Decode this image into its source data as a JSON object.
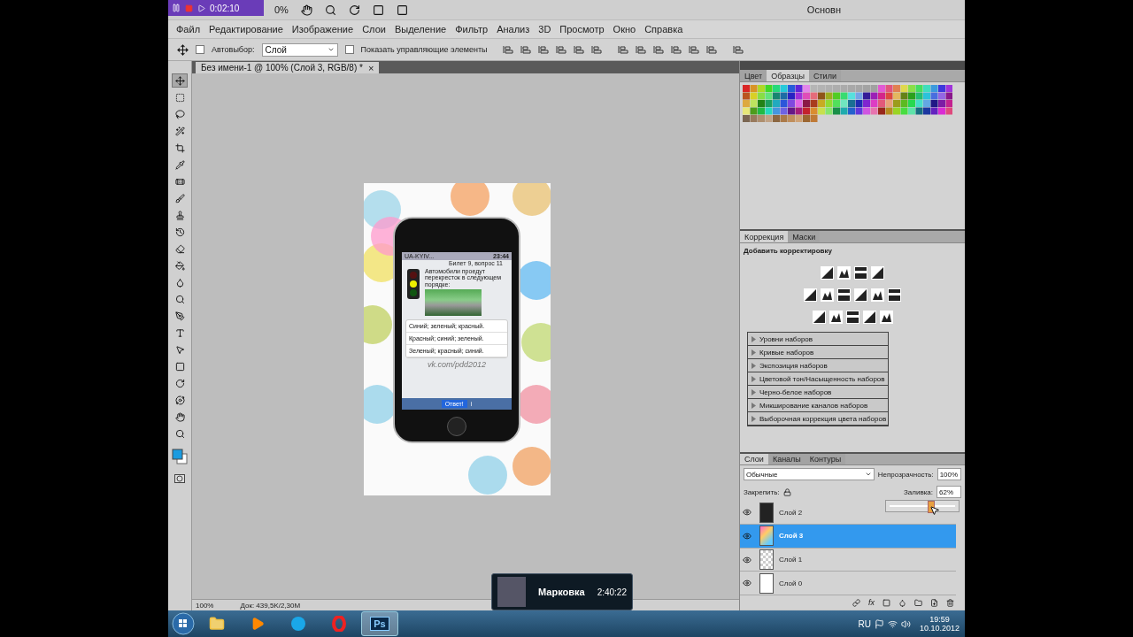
{
  "recorder": {
    "time": "0:02:10"
  },
  "app_bar": {
    "zoom": "0%",
    "workspace": "Основн"
  },
  "menu": [
    "Файл",
    "Редактирование",
    "Изображение",
    "Слои",
    "Выделение",
    "Фильтр",
    "Анализ",
    "3D",
    "Просмотр",
    "Окно",
    "Справка"
  ],
  "options": {
    "auto_select": {
      "label": "Автовыбор:",
      "checked": false
    },
    "auto_select_value": "Слой",
    "show_controls": {
      "label": "Показать управляющие элементы",
      "checked": false
    }
  },
  "document_tab": {
    "title": "Без имени-1 @ 100% (Слой 3, RGB/8) *",
    "close": "×"
  },
  "tools": [
    {
      "kind": "move",
      "selected": true
    },
    {
      "kind": "marquee",
      "selected": false
    },
    {
      "kind": "lasso",
      "selected": false
    },
    {
      "kind": "wand",
      "selected": false
    },
    {
      "kind": "crop",
      "selected": false
    },
    {
      "kind": "eyedropper",
      "selected": false
    },
    {
      "kind": "healing",
      "selected": false
    },
    {
      "kind": "brush",
      "selected": false
    },
    {
      "kind": "stamp",
      "selected": false
    },
    {
      "kind": "history",
      "selected": false
    },
    {
      "kind": "eraser",
      "selected": false
    },
    {
      "kind": "gradient",
      "selected": false
    },
    {
      "kind": "blur",
      "selected": false
    },
    {
      "kind": "dodge",
      "selected": false
    },
    {
      "kind": "pen",
      "selected": false
    },
    {
      "kind": "type",
      "selected": false
    },
    {
      "kind": "path",
      "selected": false
    },
    {
      "kind": "shape",
      "selected": false
    },
    {
      "kind": "rotate",
      "selected": false
    },
    {
      "kind": "orbit",
      "selected": false
    },
    {
      "kind": "hand",
      "selected": false
    },
    {
      "kind": "zoom",
      "selected": false
    }
  ],
  "phone": {
    "carrier": "UA-KYIV...",
    "time": "23:44",
    "title": "Билет 9, вопрос 11",
    "question": "Автомобили проедут перекресток в следующем порядке:",
    "answers": [
      "Синий; зеленый; красный.",
      "Красный; синий; зеленый.",
      "Зеленый; красный; синий."
    ],
    "link": "vk.com/pdd2012",
    "answer_button": "Ответ!",
    "info": "i"
  },
  "status_bar": {
    "zoom": "100%",
    "doc": "Док: 439,5K/2,30M"
  },
  "swatches_panel": {
    "tabs": [
      {
        "label": "Цвет",
        "selected": false
      },
      {
        "label": "Образцы",
        "selected": true
      },
      {
        "label": "Стили",
        "selected": false
      }
    ]
  },
  "adjustments_panel": {
    "tabs": [
      {
        "label": "Коррекция",
        "selected": true
      },
      {
        "label": "Маски",
        "selected": false
      }
    ],
    "heading": "Добавить корректировку",
    "presets": [
      "Уровни наборов",
      "Кривые наборов",
      "Экспозиция наборов",
      "Цветовой тон/Насыщенность наборов",
      "Черно-белое наборов",
      "Микширование каналов наборов",
      "Выборочная коррекция цвета наборов"
    ]
  },
  "layers_panel": {
    "tabs": [
      {
        "label": "Слои",
        "selected": true
      },
      {
        "label": "Каналы",
        "selected": false
      },
      {
        "label": "Контуры",
        "selected": false
      }
    ],
    "blend_mode": "Обычные",
    "opacity_label": "Непрозрачность:",
    "opacity": "100%",
    "lock_label": "Закрепить:",
    "fill_label": "Заливка:",
    "fx_label": "fx",
    "fill": "62%",
    "fill_slider": {
      "level": 0.62
    },
    "layers": [
      {
        "name": "Слой 2",
        "kind": "phone",
        "visible": true,
        "selected": false
      },
      {
        "name": "Слой 3",
        "kind": "balloons",
        "visible": true,
        "selected": true
      },
      {
        "name": "Слой 1",
        "kind": "transparent",
        "visible": true,
        "selected": false
      },
      {
        "name": "Слой 0",
        "kind": "white",
        "visible": true,
        "selected": false
      }
    ]
  },
  "notification": {
    "title": "Марковка",
    "time": "2:40:22"
  },
  "taskbar": {
    "apps": [
      {
        "kind": "explorer",
        "selected": false
      },
      {
        "kind": "media",
        "selected": false
      },
      {
        "kind": "skype",
        "selected": false
      },
      {
        "kind": "opera",
        "selected": false
      },
      {
        "kind": "photoshop",
        "selected": true
      }
    ],
    "photoshop_label": "Ps",
    "language": "RU",
    "time": "19:59",
    "date": "10.10.2012"
  }
}
